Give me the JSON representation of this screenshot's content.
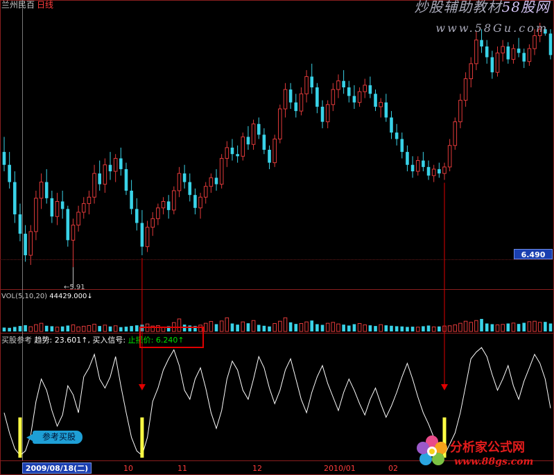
{
  "header": {
    "stock_name": "兰州民百",
    "period": "日线",
    "watermark_brand": "炒股辅助教材",
    "watermark_accent": "58股网",
    "watermark_url": "www.58Gu.com"
  },
  "price_panel": {
    "current_price_tag": "6.490",
    "low_marker_label": "5.91",
    "up_color": "#e23a3a",
    "down_color": "#39d3e8"
  },
  "volume_panel": {
    "legend_label": "VOL(5,10,20)",
    "legend_value": "44429.000",
    "legend_arrow": "↓"
  },
  "indicator_panel": {
    "name": "买股参考",
    "trend_label": "趋势:",
    "trend_value": "23.601",
    "trend_arrow": "↑",
    "signal_label": ", 买入信号:",
    "stop_label": "止损价:",
    "stop_value": "6.240",
    "stop_arrow": "↑",
    "buy_tag": "参考买股",
    "line_color": "#ffffff",
    "signal_color": "#ffff44"
  },
  "time_axis": {
    "selected_date": "2009/08/18(二)",
    "labels": [
      "10",
      "11",
      "12",
      "2010/01",
      "02"
    ]
  },
  "footer_logo": {
    "name": "分析家公式网",
    "url": "www.88gs.com"
  },
  "chart_data": {
    "type": "candlestick",
    "price_range": [
      5.75,
      8.25
    ],
    "volume_range": [
      0,
      280000
    ],
    "oscillator_range": [
      0,
      100
    ],
    "candles": [
      {
        "o": 6.98,
        "h": 7.12,
        "l": 6.8,
        "c": 6.86
      },
      {
        "o": 6.86,
        "h": 6.98,
        "l": 6.64,
        "c": 6.7
      },
      {
        "o": 6.7,
        "h": 6.8,
        "l": 6.32,
        "c": 6.4
      },
      {
        "o": 6.4,
        "h": 6.5,
        "l": 6.15,
        "c": 6.22
      },
      {
        "o": 6.22,
        "h": 6.3,
        "l": 5.96,
        "c": 6.02
      },
      {
        "o": 6.02,
        "h": 6.3,
        "l": 5.93,
        "c": 6.24
      },
      {
        "o": 6.24,
        "h": 6.62,
        "l": 6.16,
        "c": 6.55
      },
      {
        "o": 6.55,
        "h": 6.78,
        "l": 6.45,
        "c": 6.7
      },
      {
        "o": 6.7,
        "h": 6.82,
        "l": 6.5,
        "c": 6.55
      },
      {
        "o": 6.55,
        "h": 6.62,
        "l": 6.32,
        "c": 6.38
      },
      {
        "o": 6.38,
        "h": 6.6,
        "l": 6.3,
        "c": 6.52
      },
      {
        "o": 6.52,
        "h": 6.62,
        "l": 6.36,
        "c": 6.45
      },
      {
        "o": 6.45,
        "h": 6.48,
        "l": 6.1,
        "c": 6.16
      },
      {
        "o": 6.16,
        "h": 6.36,
        "l": 5.91,
        "c": 6.3
      },
      {
        "o": 6.3,
        "h": 6.48,
        "l": 6.24,
        "c": 6.42
      },
      {
        "o": 6.42,
        "h": 6.56,
        "l": 6.36,
        "c": 6.5
      },
      {
        "o": 6.5,
        "h": 6.62,
        "l": 6.4,
        "c": 6.56
      },
      {
        "o": 6.56,
        "h": 6.86,
        "l": 6.5,
        "c": 6.78
      },
      {
        "o": 6.78,
        "h": 6.9,
        "l": 6.62,
        "c": 6.68
      },
      {
        "o": 6.68,
        "h": 6.92,
        "l": 6.6,
        "c": 6.86
      },
      {
        "o": 6.86,
        "h": 6.98,
        "l": 6.72,
        "c": 6.8
      },
      {
        "o": 6.8,
        "h": 6.96,
        "l": 6.7,
        "c": 6.92
      },
      {
        "o": 6.92,
        "h": 7.02,
        "l": 6.76,
        "c": 6.82
      },
      {
        "o": 6.82,
        "h": 6.88,
        "l": 6.58,
        "c": 6.62
      },
      {
        "o": 6.62,
        "h": 6.72,
        "l": 6.4,
        "c": 6.45
      },
      {
        "o": 6.45,
        "h": 6.55,
        "l": 6.25,
        "c": 6.32
      },
      {
        "o": 6.32,
        "h": 6.44,
        "l": 6.02,
        "c": 6.1
      },
      {
        "o": 6.1,
        "h": 6.34,
        "l": 6.05,
        "c": 6.28
      },
      {
        "o": 6.28,
        "h": 6.42,
        "l": 6.2,
        "c": 6.36
      },
      {
        "o": 6.36,
        "h": 6.5,
        "l": 6.3,
        "c": 6.46
      },
      {
        "o": 6.46,
        "h": 6.56,
        "l": 6.4,
        "c": 6.52
      },
      {
        "o": 6.52,
        "h": 6.58,
        "l": 6.36,
        "c": 6.44
      },
      {
        "o": 6.44,
        "h": 6.66,
        "l": 6.4,
        "c": 6.62
      },
      {
        "o": 6.62,
        "h": 6.84,
        "l": 6.56,
        "c": 6.78
      },
      {
        "o": 6.78,
        "h": 6.86,
        "l": 6.64,
        "c": 6.7
      },
      {
        "o": 6.7,
        "h": 6.78,
        "l": 6.52,
        "c": 6.58
      },
      {
        "o": 6.58,
        "h": 6.64,
        "l": 6.4,
        "c": 6.46
      },
      {
        "o": 6.46,
        "h": 6.6,
        "l": 6.36,
        "c": 6.56
      },
      {
        "o": 6.56,
        "h": 6.7,
        "l": 6.5,
        "c": 6.66
      },
      {
        "o": 6.66,
        "h": 6.78,
        "l": 6.6,
        "c": 6.74
      },
      {
        "o": 6.74,
        "h": 6.82,
        "l": 6.62,
        "c": 6.68
      },
      {
        "o": 6.68,
        "h": 6.96,
        "l": 6.64,
        "c": 6.92
      },
      {
        "o": 6.92,
        "h": 7.08,
        "l": 6.84,
        "c": 7.02
      },
      {
        "o": 7.02,
        "h": 7.1,
        "l": 6.9,
        "c": 6.96
      },
      {
        "o": 6.96,
        "h": 7.04,
        "l": 6.88,
        "c": 6.94
      },
      {
        "o": 6.94,
        "h": 7.16,
        "l": 6.9,
        "c": 7.12
      },
      {
        "o": 7.12,
        "h": 7.22,
        "l": 7.0,
        "c": 7.05
      },
      {
        "o": 7.05,
        "h": 7.28,
        "l": 7.0,
        "c": 7.24
      },
      {
        "o": 7.24,
        "h": 7.3,
        "l": 7.1,
        "c": 7.14
      },
      {
        "o": 7.14,
        "h": 7.2,
        "l": 6.96,
        "c": 7.0
      },
      {
        "o": 7.0,
        "h": 7.04,
        "l": 6.82,
        "c": 6.88
      },
      {
        "o": 6.88,
        "h": 7.14,
        "l": 6.84,
        "c": 7.1
      },
      {
        "o": 7.1,
        "h": 7.42,
        "l": 7.06,
        "c": 7.38
      },
      {
        "o": 7.38,
        "h": 7.62,
        "l": 7.3,
        "c": 7.56
      },
      {
        "o": 7.56,
        "h": 7.62,
        "l": 7.38,
        "c": 7.44
      },
      {
        "o": 7.44,
        "h": 7.52,
        "l": 7.3,
        "c": 7.36
      },
      {
        "o": 7.36,
        "h": 7.58,
        "l": 7.32,
        "c": 7.52
      },
      {
        "o": 7.52,
        "h": 7.74,
        "l": 7.44,
        "c": 7.68
      },
      {
        "o": 7.68,
        "h": 7.8,
        "l": 7.52,
        "c": 7.58
      },
      {
        "o": 7.58,
        "h": 7.62,
        "l": 7.34,
        "c": 7.4
      },
      {
        "o": 7.4,
        "h": 7.46,
        "l": 7.2,
        "c": 7.26
      },
      {
        "o": 7.26,
        "h": 7.46,
        "l": 7.2,
        "c": 7.42
      },
      {
        "o": 7.42,
        "h": 7.62,
        "l": 7.36,
        "c": 7.56
      },
      {
        "o": 7.56,
        "h": 7.7,
        "l": 7.48,
        "c": 7.64
      },
      {
        "o": 7.64,
        "h": 7.74,
        "l": 7.52,
        "c": 7.58
      },
      {
        "o": 7.58,
        "h": 7.64,
        "l": 7.44,
        "c": 7.5
      },
      {
        "o": 7.5,
        "h": 7.6,
        "l": 7.38,
        "c": 7.44
      },
      {
        "o": 7.44,
        "h": 7.58,
        "l": 7.4,
        "c": 7.54
      },
      {
        "o": 7.54,
        "h": 7.66,
        "l": 7.48,
        "c": 7.6
      },
      {
        "o": 7.6,
        "h": 7.68,
        "l": 7.48,
        "c": 7.52
      },
      {
        "o": 7.52,
        "h": 7.56,
        "l": 7.36,
        "c": 7.4
      },
      {
        "o": 7.4,
        "h": 7.48,
        "l": 7.3,
        "c": 7.44
      },
      {
        "o": 7.44,
        "h": 7.52,
        "l": 7.26,
        "c": 7.3
      },
      {
        "o": 7.3,
        "h": 7.36,
        "l": 7.1,
        "c": 7.16
      },
      {
        "o": 7.16,
        "h": 7.24,
        "l": 7.04,
        "c": 7.1
      },
      {
        "o": 7.1,
        "h": 7.16,
        "l": 6.92,
        "c": 6.98
      },
      {
        "o": 6.98,
        "h": 7.04,
        "l": 6.8,
        "c": 6.86
      },
      {
        "o": 6.86,
        "h": 6.94,
        "l": 6.74,
        "c": 6.8
      },
      {
        "o": 6.8,
        "h": 6.94,
        "l": 6.76,
        "c": 6.9
      },
      {
        "o": 6.9,
        "h": 6.98,
        "l": 6.8,
        "c": 6.84
      },
      {
        "o": 6.84,
        "h": 6.9,
        "l": 6.72,
        "c": 6.76
      },
      {
        "o": 6.76,
        "h": 6.86,
        "l": 6.7,
        "c": 6.82
      },
      {
        "o": 6.82,
        "h": 6.88,
        "l": 6.74,
        "c": 6.78
      },
      {
        "o": 6.78,
        "h": 6.88,
        "l": 6.72,
        "c": 6.84
      },
      {
        "o": 6.84,
        "h": 7.1,
        "l": 6.8,
        "c": 7.04
      },
      {
        "o": 7.04,
        "h": 7.3,
        "l": 7.0,
        "c": 7.26
      },
      {
        "o": 7.26,
        "h": 7.52,
        "l": 7.2,
        "c": 7.46
      },
      {
        "o": 7.46,
        "h": 7.72,
        "l": 7.4,
        "c": 7.66
      },
      {
        "o": 7.66,
        "h": 7.86,
        "l": 7.58,
        "c": 7.8
      },
      {
        "o": 7.8,
        "h": 8.1,
        "l": 7.74,
        "c": 8.02
      },
      {
        "o": 8.02,
        "h": 8.12,
        "l": 7.9,
        "c": 7.96
      },
      {
        "o": 7.96,
        "h": 8.02,
        "l": 7.8,
        "c": 7.86
      },
      {
        "o": 7.86,
        "h": 7.92,
        "l": 7.66,
        "c": 7.72
      },
      {
        "o": 7.72,
        "h": 7.96,
        "l": 7.68,
        "c": 7.9
      },
      {
        "o": 7.9,
        "h": 8.02,
        "l": 7.82,
        "c": 7.96
      },
      {
        "o": 7.96,
        "h": 8.0,
        "l": 7.8,
        "c": 7.84
      },
      {
        "o": 7.84,
        "h": 7.98,
        "l": 7.8,
        "c": 7.94
      },
      {
        "o": 7.94,
        "h": 8.04,
        "l": 7.86,
        "c": 7.9
      },
      {
        "o": 7.9,
        "h": 7.94,
        "l": 7.76,
        "c": 7.82
      },
      {
        "o": 7.82,
        "h": 7.98,
        "l": 7.78,
        "c": 7.94
      },
      {
        "o": 7.94,
        "h": 8.12,
        "l": 7.88,
        "c": 8.06
      },
      {
        "o": 8.06,
        "h": 8.18,
        "l": 8.0,
        "c": 8.12
      },
      {
        "o": 8.12,
        "h": 8.14,
        "l": 8.06,
        "c": 8.08
      },
      {
        "o": 8.08,
        "h": 8.12,
        "l": 7.84,
        "c": 7.88
      }
    ],
    "volume": [
      34,
      32,
      40,
      48,
      55,
      42,
      60,
      72,
      50,
      46,
      38,
      44,
      52,
      58,
      40,
      46,
      52,
      64,
      48,
      56,
      44,
      50,
      38,
      42,
      48,
      54,
      60,
      66,
      48,
      52,
      40,
      46,
      78,
      110,
      60,
      52,
      48,
      56,
      72,
      88,
      64,
      92,
      120,
      70,
      60,
      84,
      72,
      96,
      58,
      50,
      44,
      70,
      90,
      120,
      80,
      66,
      70,
      84,
      96,
      64,
      58,
      72,
      80,
      66,
      60,
      52,
      64,
      70,
      58,
      54,
      48,
      60,
      54,
      50,
      46,
      44,
      40,
      42,
      38,
      46,
      52,
      40,
      44,
      48,
      50,
      58,
      72,
      90,
      80,
      96,
      110,
      70,
      64,
      58,
      62,
      70,
      74,
      66,
      76,
      86,
      90,
      80,
      84,
      70
    ],
    "oscillator": [
      40,
      22,
      8,
      2,
      6,
      20,
      50,
      70,
      60,
      42,
      28,
      38,
      64,
      56,
      40,
      72,
      80,
      92,
      70,
      62,
      72,
      90,
      64,
      40,
      18,
      6,
      2,
      18,
      50,
      62,
      78,
      88,
      96,
      82,
      60,
      52,
      70,
      80,
      62,
      40,
      26,
      42,
      70,
      86,
      78,
      60,
      52,
      70,
      90,
      80,
      62,
      48,
      60,
      78,
      88,
      70,
      52,
      40,
      58,
      72,
      82,
      66,
      54,
      42,
      58,
      70,
      60,
      48,
      38,
      52,
      62,
      48,
      36,
      46,
      58,
      72,
      84,
      70,
      54,
      40,
      30,
      18,
      8,
      2,
      12,
      22,
      40,
      64,
      88,
      94,
      98,
      90,
      74,
      60,
      70,
      82,
      64,
      52,
      68,
      80,
      92,
      84,
      70,
      44,
      38
    ],
    "buy_signals": [
      3,
      26,
      83
    ],
    "signal_arrows": [
      26,
      83
    ]
  }
}
